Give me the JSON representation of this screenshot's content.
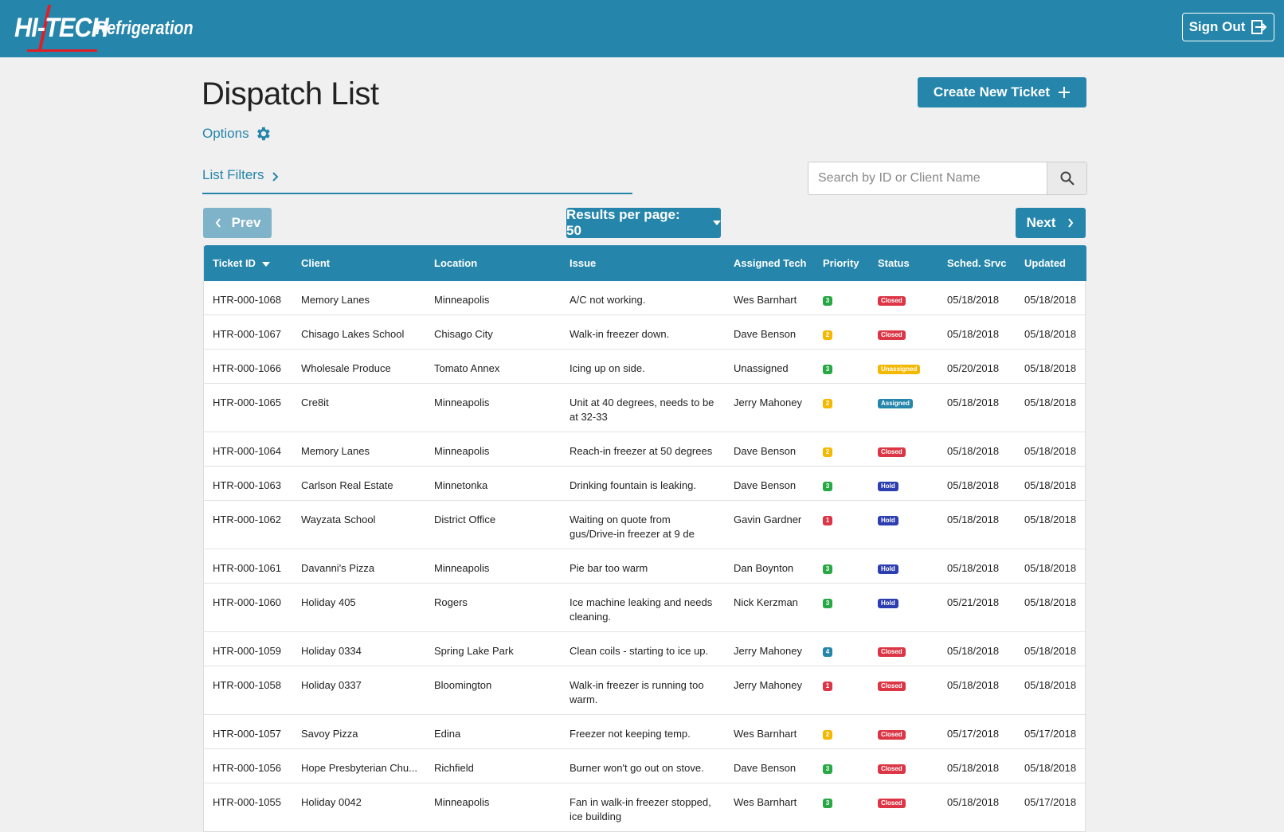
{
  "brand": {
    "logo_main": "HI-TECH",
    "logo_sub": "Refrigeration",
    "red": "#e21d26",
    "primary": "#2585ab"
  },
  "header": {
    "signout_label": "Sign Out",
    "signout_icon": "sign-out-icon"
  },
  "page": {
    "title": "Dispatch List",
    "create_label": "Create New Ticket",
    "create_icon": "plus-icon"
  },
  "options": {
    "label": "Options",
    "icon": "gear-icon"
  },
  "filters": {
    "label": "List Filters",
    "icon": "chevron-right-icon"
  },
  "search": {
    "placeholder": "Search by ID or Client Name",
    "icon": "search-icon"
  },
  "pager": {
    "prev_label": "Prev",
    "next_label": "Next",
    "rpp_label": "Results per page: 50"
  },
  "table": {
    "columns": [
      "Ticket ID",
      "Client",
      "Location",
      "Issue",
      "Assigned Tech",
      "Priority",
      "Status",
      "Sched. Srvc",
      "Updated"
    ],
    "sorted_column": "Ticket ID",
    "priority_colors": {
      "1": "#dc3545",
      "2": "#f5b800",
      "3": "#28a745",
      "4": "#2585ab"
    },
    "status_colors": {
      "Closed": "#dc3545",
      "Unassigned": "#f5b800",
      "Assigned": "#2585ab",
      "Hold": "#2c3eb0"
    },
    "rows": [
      {
        "id": "HTR-000-1068",
        "client": "Memory Lanes",
        "location": "Minneapolis",
        "issue": "A/C not working.",
        "tech": "Wes Barnhart",
        "priority": "3",
        "status": "Closed",
        "sched": "05/18/2018",
        "updated": "05/18/2018"
      },
      {
        "id": "HTR-000-1067",
        "client": "Chisago Lakes School",
        "location": "Chisago City",
        "issue": "Walk-in freezer down.",
        "tech": "Dave Benson",
        "priority": "2",
        "status": "Closed",
        "sched": "05/18/2018",
        "updated": "05/18/2018"
      },
      {
        "id": "HTR-000-1066",
        "client": "Wholesale Produce",
        "location": "Tomato Annex",
        "issue": "Icing up on side.",
        "tech": "Unassigned",
        "priority": "3",
        "status": "Unassigned",
        "sched": "05/20/2018",
        "updated": "05/18/2018"
      },
      {
        "id": "HTR-000-1065",
        "client": "Cre8it",
        "location": "Minneapolis",
        "issue": "Unit at 40 degrees, needs to be at 32-33",
        "tech": "Jerry Mahoney",
        "priority": "2",
        "status": "Assigned",
        "sched": "05/18/2018",
        "updated": "05/18/2018"
      },
      {
        "id": "HTR-000-1064",
        "client": "Memory Lanes",
        "location": "Minneapolis",
        "issue": "Reach-in freezer at 50 degrees",
        "tech": "Dave Benson",
        "priority": "2",
        "status": "Closed",
        "sched": "05/18/2018",
        "updated": "05/18/2018"
      },
      {
        "id": "HTR-000-1063",
        "client": "Carlson Real Estate",
        "location": "Minnetonka",
        "issue": "Drinking fountain is leaking.",
        "tech": "Dave Benson",
        "priority": "3",
        "status": "Hold",
        "sched": "05/18/2018",
        "updated": "05/18/2018"
      },
      {
        "id": "HTR-000-1062",
        "client": "Wayzata School",
        "location": "District Office",
        "issue": "Waiting on quote from gus/Drive-in freezer at 9 de",
        "tech": "Gavin Gardner",
        "priority": "1",
        "status": "Hold",
        "sched": "05/18/2018",
        "updated": "05/18/2018"
      },
      {
        "id": "HTR-000-1061",
        "client": "Davanni's Pizza",
        "location": "Minneapolis",
        "issue": "Pie bar too warm",
        "tech": "Dan Boynton",
        "priority": "3",
        "status": "Hold",
        "sched": "05/18/2018",
        "updated": "05/18/2018"
      },
      {
        "id": "HTR-000-1060",
        "client": "Holiday 405",
        "location": "Rogers",
        "issue": "Ice machine leaking and needs cleaning.",
        "tech": "Nick Kerzman",
        "priority": "3",
        "status": "Hold",
        "sched": "05/21/2018",
        "updated": "05/18/2018"
      },
      {
        "id": "HTR-000-1059",
        "client": "Holiday 0334",
        "location": "Spring Lake Park",
        "issue": "Clean coils - starting to ice up.",
        "tech": "Jerry Mahoney",
        "priority": "4",
        "status": "Closed",
        "sched": "05/18/2018",
        "updated": "05/18/2018"
      },
      {
        "id": "HTR-000-1058",
        "client": "Holiday 0337",
        "location": "Bloomington",
        "issue": "Walk-in freezer is running too warm.",
        "tech": "Jerry Mahoney",
        "priority": "1",
        "status": "Closed",
        "sched": "05/18/2018",
        "updated": "05/18/2018"
      },
      {
        "id": "HTR-000-1057",
        "client": "Savoy Pizza",
        "location": "Edina",
        "issue": "Freezer not keeping temp.",
        "tech": "Wes Barnhart",
        "priority": "2",
        "status": "Closed",
        "sched": "05/17/2018",
        "updated": "05/17/2018"
      },
      {
        "id": "HTR-000-1056",
        "client": "Hope Presbyterian Chu...",
        "location": "Richfield",
        "issue": "Burner won't go out on stove.",
        "tech": "Dave Benson",
        "priority": "3",
        "status": "Closed",
        "sched": "05/18/2018",
        "updated": "05/18/2018"
      },
      {
        "id": "HTR-000-1055",
        "client": "Holiday 0042",
        "location": "Minneapolis",
        "issue": "Fan in walk-in freezer stopped, ice building",
        "tech": "Wes Barnhart",
        "priority": "3",
        "status": "Closed",
        "sched": "05/18/2018",
        "updated": "05/17/2018"
      }
    ]
  }
}
